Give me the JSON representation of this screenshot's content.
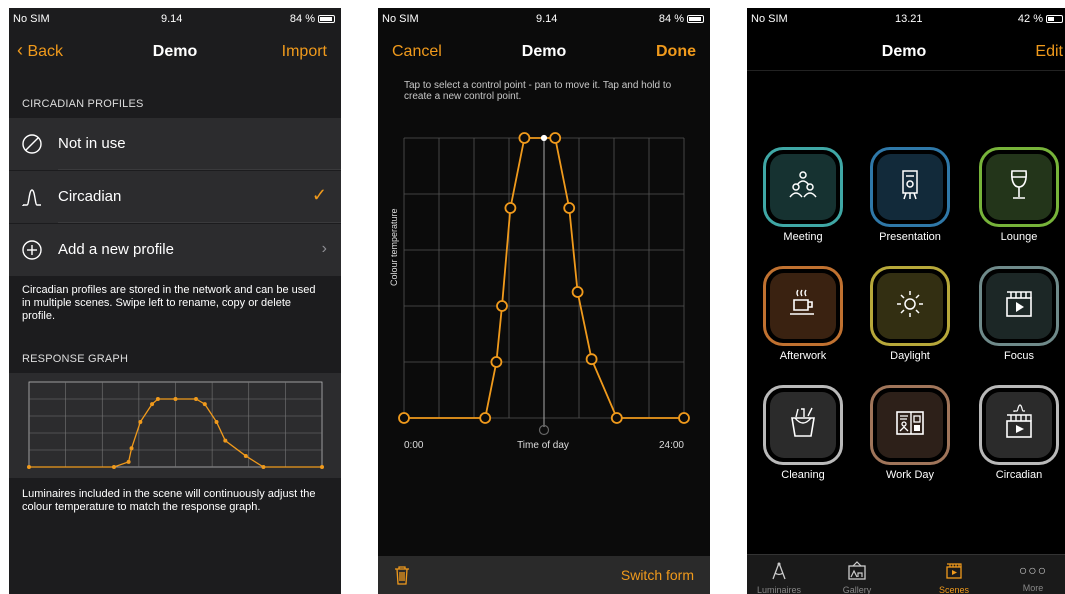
{
  "screen1": {
    "status": {
      "carrier": "No SIM",
      "time": "9.14",
      "battery": "84 %"
    },
    "nav": {
      "back": "Back",
      "title": "Demo",
      "action": "Import"
    },
    "profiles_header": "CIRCADIAN PROFILES",
    "rows": [
      {
        "label": "Not in use",
        "icon": "not-in-use-icon"
      },
      {
        "label": "Circadian",
        "icon": "circadian-curve-icon",
        "selected": true
      },
      {
        "label": "Add a new profile",
        "icon": "plus-circle-icon"
      }
    ],
    "profiles_note": "Circadian profiles are stored in the network and can be used in multiple scenes. Swipe left to rename, copy or delete profile.",
    "graph_header": "RESPONSE GRAPH",
    "graph_note": "Luminaires included in the scene will continuously adjust the colour temperature to match the response graph.",
    "response_points": [
      [
        0,
        0
      ],
      [
        0.29,
        0
      ],
      [
        0.34,
        0.06
      ],
      [
        0.35,
        0.22
      ],
      [
        0.38,
        0.53
      ],
      [
        0.42,
        0.74
      ],
      [
        0.44,
        0.8
      ],
      [
        0.5,
        0.8
      ],
      [
        0.57,
        0.8
      ],
      [
        0.6,
        0.74
      ],
      [
        0.64,
        0.53
      ],
      [
        0.67,
        0.31
      ],
      [
        0.74,
        0.13
      ],
      [
        0.8,
        0
      ],
      [
        1,
        0
      ]
    ]
  },
  "screen2": {
    "status": {
      "carrier": "No SIM",
      "time": "9.14",
      "battery": "84 %"
    },
    "nav": {
      "cancel": "Cancel",
      "title": "Demo",
      "done": "Done"
    },
    "hint": "Tap to select a control point - pan to move it. Tap and hold to create a new control point.",
    "y_label": "Colour temperature",
    "x_start": "0:00",
    "x_mid": "Time of day",
    "x_end": "24:00",
    "control_points": [
      [
        0,
        0
      ],
      [
        0.29,
        0
      ],
      [
        0.33,
        0.2
      ],
      [
        0.35,
        0.4
      ],
      [
        0.38,
        0.75
      ],
      [
        0.43,
        1
      ],
      [
        0.5,
        1
      ],
      [
        0.54,
        1
      ],
      [
        0.59,
        0.75
      ],
      [
        0.62,
        0.45
      ],
      [
        0.67,
        0.21
      ],
      [
        0.76,
        0
      ],
      [
        1,
        0
      ]
    ],
    "bottom": {
      "delete_icon": "trash-icon",
      "switch_form": "Switch form"
    }
  },
  "screen3": {
    "status": {
      "carrier": "No SIM",
      "time": "13.21",
      "battery": "42 %"
    },
    "nav": {
      "title": "Demo",
      "edit": "Edit"
    },
    "scenes": [
      {
        "label": "Meeting",
        "icon": "people-icon",
        "color": "#3fa7a5",
        "bg": "#163231"
      },
      {
        "label": "Presentation",
        "icon": "presentation-icon",
        "color": "#2f78a8",
        "bg": "#122a3a"
      },
      {
        "label": "Lounge",
        "icon": "wine-glass-icon",
        "color": "#77b33a",
        "bg": "#23351a"
      },
      {
        "label": "Afterwork",
        "icon": "coffee-cup-icon",
        "color": "#c07130",
        "bg": "#3a2211"
      },
      {
        "label": "Daylight",
        "icon": "sun-icon",
        "color": "#b7a83a",
        "bg": "#332f12"
      },
      {
        "label": "Focus",
        "icon": "clapperboard-icon",
        "color": "#6f8a8a",
        "bg": "#1c2726"
      },
      {
        "label": "Cleaning",
        "icon": "cleaning-bucket-icon",
        "color": "#b9b9b9",
        "bg": "#2b2b2b"
      },
      {
        "label": "Work Day",
        "icon": "workday-board-icon",
        "color": "#a0755a",
        "bg": "#2d2019"
      },
      {
        "label": "Circadian",
        "icon": "circadian-clapperboard-icon",
        "color": "#b9b9b9",
        "bg": "#2b2b2b"
      }
    ],
    "tabs": [
      {
        "label": "Luminaires",
        "icon": "compass-icon"
      },
      {
        "label": "Gallery",
        "icon": "gallery-icon"
      },
      {
        "label": "Scenes",
        "icon": "scenes-icon",
        "active": true
      },
      {
        "label": "More",
        "icon": "more-dots-icon"
      }
    ]
  },
  "colors": {
    "accent": "#f09a1c"
  }
}
